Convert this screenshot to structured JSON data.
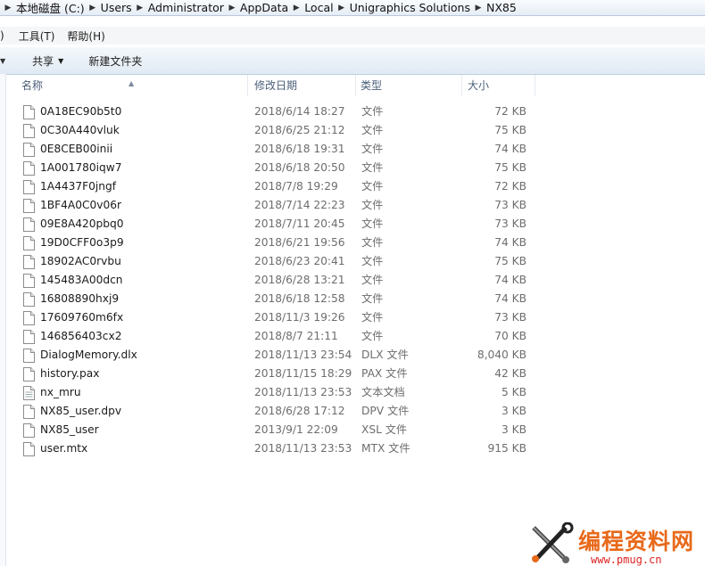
{
  "address": {
    "crumbs": [
      "本地磁盘 (C:)",
      "Users",
      "Administrator",
      "AppData",
      "Local",
      "Unigraphics Solutions",
      "NX85"
    ]
  },
  "menu": {
    "partial": ")",
    "tools": "工具(T)",
    "help": "帮助(H)"
  },
  "toolbar": {
    "share": "共享",
    "new_folder": "新建文件夹"
  },
  "columns": {
    "name": "名称",
    "modified": "修改日期",
    "type": "类型",
    "size": "大小"
  },
  "files": [
    {
      "name": "0A18EC90b5t0",
      "date": "2018/6/14 18:27",
      "type": "文件",
      "size": "72 KB",
      "icon": "blank-file-icon"
    },
    {
      "name": "0C30A440vluk",
      "date": "2018/6/25 21:12",
      "type": "文件",
      "size": "75 KB",
      "icon": "blank-file-icon"
    },
    {
      "name": "0E8CEB00inii",
      "date": "2018/6/18 19:31",
      "type": "文件",
      "size": "74 KB",
      "icon": "blank-file-icon"
    },
    {
      "name": "1A001780iqw7",
      "date": "2018/6/18 20:50",
      "type": "文件",
      "size": "75 KB",
      "icon": "blank-file-icon"
    },
    {
      "name": "1A4437F0jngf",
      "date": "2018/7/8 19:29",
      "type": "文件",
      "size": "72 KB",
      "icon": "blank-file-icon"
    },
    {
      "name": "1BF4A0C0v06r",
      "date": "2018/7/14 22:23",
      "type": "文件",
      "size": "73 KB",
      "icon": "blank-file-icon"
    },
    {
      "name": "09E8A420pbq0",
      "date": "2018/7/11 20:45",
      "type": "文件",
      "size": "73 KB",
      "icon": "blank-file-icon"
    },
    {
      "name": "19D0CFF0o3p9",
      "date": "2018/6/21 19:56",
      "type": "文件",
      "size": "74 KB",
      "icon": "blank-file-icon"
    },
    {
      "name": "18902AC0rvbu",
      "date": "2018/6/23 20:41",
      "type": "文件",
      "size": "75 KB",
      "icon": "blank-file-icon"
    },
    {
      "name": "145483A00dcn",
      "date": "2018/6/28 13:21",
      "type": "文件",
      "size": "74 KB",
      "icon": "blank-file-icon"
    },
    {
      "name": "16808890hxj9",
      "date": "2018/6/18 12:58",
      "type": "文件",
      "size": "74 KB",
      "icon": "blank-file-icon"
    },
    {
      "name": "17609760m6fx",
      "date": "2018/11/3 19:26",
      "type": "文件",
      "size": "73 KB",
      "icon": "blank-file-icon"
    },
    {
      "name": "146856403cx2",
      "date": "2018/8/7 21:11",
      "type": "文件",
      "size": "70 KB",
      "icon": "blank-file-icon"
    },
    {
      "name": "DialogMemory.dlx",
      "date": "2018/11/13 23:54",
      "type": "DLX 文件",
      "size": "8,040 KB",
      "icon": "blank-file-icon"
    },
    {
      "name": "history.pax",
      "date": "2018/11/15 18:29",
      "type": "PAX 文件",
      "size": "42 KB",
      "icon": "blank-file-icon"
    },
    {
      "name": "nx_mru",
      "date": "2018/11/13 23:53",
      "type": "文本文档",
      "size": "5 KB",
      "icon": "text-document-icon"
    },
    {
      "name": "NX85_user.dpv",
      "date": "2018/6/28 17:12",
      "type": "DPV 文件",
      "size": "3 KB",
      "icon": "blank-file-icon"
    },
    {
      "name": "NX85_user",
      "date": "2013/9/1 22:09",
      "type": "XSL 文件",
      "size": "3 KB",
      "icon": "blank-file-icon"
    },
    {
      "name": "user.mtx",
      "date": "2018/11/13 23:53",
      "type": "MTX 文件",
      "size": "915 KB",
      "icon": "blank-file-icon"
    }
  ],
  "watermark": {
    "title": "编程资料网",
    "url": "www.pmug.cn"
  }
}
